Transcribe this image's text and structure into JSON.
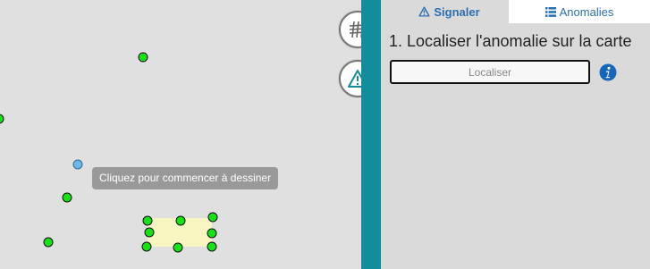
{
  "map": {
    "tooltip": "Cliquez pour commencer à dessiner",
    "controls": {
      "grid_button_icon": "grid-icon",
      "alert_button_icon": "warning-icon"
    }
  },
  "panel": {
    "tabs": [
      {
        "label": "Signaler",
        "icon": "warning-icon",
        "active": true
      },
      {
        "label": "Anomalies",
        "icon": "list-icon",
        "active": false
      }
    ],
    "step_title": "1. Localiser l'anomalie sur la carte",
    "locate_button": "Localiser",
    "info_icon": "info-icon"
  },
  "colors": {
    "accent": "#138d9b",
    "tab_text": "#2a6fb3",
    "marker": "#19e019",
    "marker_selected": "#6cb8e6",
    "polygon_fill": "#faf6be"
  }
}
